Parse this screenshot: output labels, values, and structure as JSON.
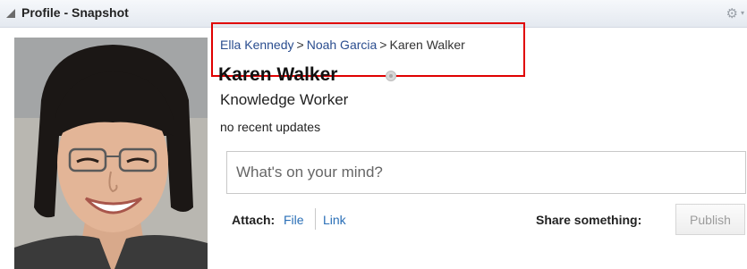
{
  "header": {
    "title": "Profile - Snapshot",
    "collapse_icon": "collapse-triangle-icon",
    "settings_icon": "gear-icon"
  },
  "breadcrumb": {
    "items": [
      "Ella Kennedy",
      "Noah Garcia",
      "Karen Walker"
    ],
    "separator": ">"
  },
  "profile": {
    "name": "Karen Walker",
    "role": "Knowledge Worker",
    "status": "no recent updates",
    "presence_icon": "presence-status-icon",
    "photo": "profile-photo"
  },
  "post": {
    "placeholder": "What's on your mind?",
    "attach_label": "Attach:",
    "attach_file": "File",
    "attach_link": "Link",
    "share_label": "Share something:",
    "publish_label": "Publish"
  },
  "colors": {
    "link": "#2a6fb7",
    "breadcrumb_link": "#2a4d8f",
    "highlight": "#e00000"
  }
}
